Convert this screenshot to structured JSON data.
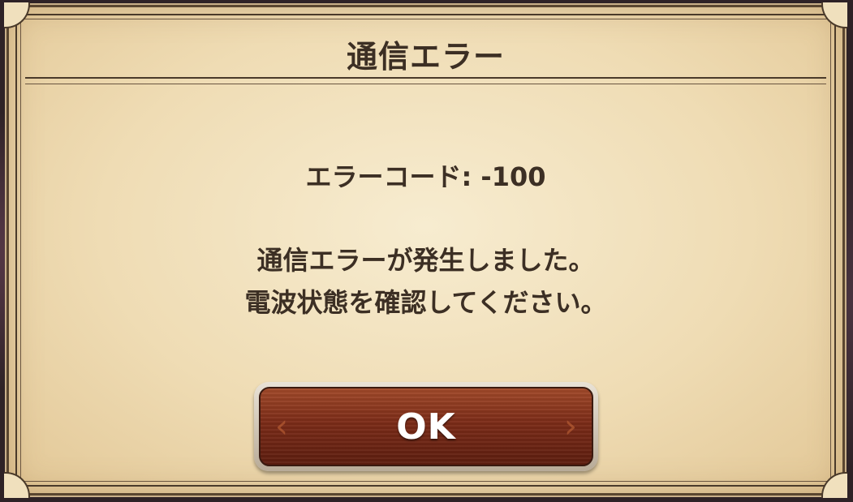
{
  "dialog": {
    "title": "通信エラー",
    "error_code": "エラーコード: -100",
    "message_line1": "通信エラーが発生しました。",
    "message_line2": "電波状態を確認してください。",
    "ok_label": "OK",
    "left_decoration": "‹",
    "right_decoration": "›"
  },
  "colors": {
    "text": "#3c2f24",
    "button": "#7c2c18",
    "parchment": "#efdcb4"
  }
}
